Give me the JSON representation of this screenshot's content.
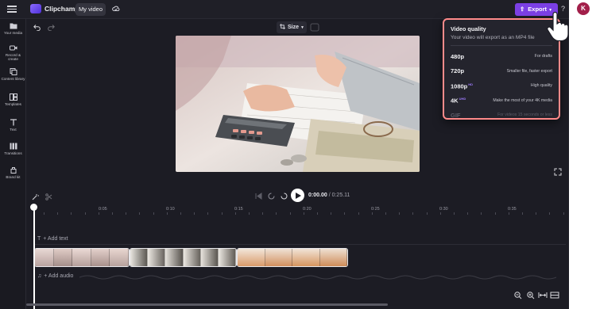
{
  "app": {
    "name": "Clipchamp",
    "project_tab": "My video",
    "export_label": "Export",
    "help_label": "?",
    "avatar_initial": "K",
    "accent_color": "#7b3fe4"
  },
  "sidebar": {
    "items": [
      {
        "label": "Your media",
        "icon": "folder-icon"
      },
      {
        "label": "Record & create",
        "icon": "video-camera-icon"
      },
      {
        "label": "Content library",
        "icon": "library-icon"
      },
      {
        "label": "Templates",
        "icon": "templates-icon"
      },
      {
        "label": "Text",
        "icon": "text-icon"
      },
      {
        "label": "Transitions",
        "icon": "transitions-icon"
      },
      {
        "label": "Brand kit",
        "icon": "brand-kit-icon"
      }
    ]
  },
  "toolbar": {
    "size_label": "Size"
  },
  "player": {
    "current_time": "0:00.00",
    "total_time": "/ 0:25.11"
  },
  "timeline": {
    "ticks": [
      "0:05",
      "0:10",
      "0:15",
      "0:20",
      "0:25",
      "0:30",
      "0:35"
    ],
    "add_text": "+ Add text",
    "add_audio": "+ Add audio"
  },
  "export_menu": {
    "title": "Video quality",
    "subtitle": "Your video will export as an MP4 file",
    "options": [
      {
        "quality": "480p",
        "badge": "",
        "description": "For drafts",
        "enabled": true
      },
      {
        "quality": "720p",
        "badge": "",
        "description": "Smaller file, faster export",
        "enabled": true
      },
      {
        "quality": "1080p",
        "badge": "HD",
        "description": "High quality",
        "enabled": true
      },
      {
        "quality": "4K",
        "badge": "UHD",
        "description": "Make the most of your 4K media",
        "enabled": true
      },
      {
        "quality": "GIF",
        "badge": "",
        "description": "For videos 15 seconds or less",
        "enabled": false
      }
    ]
  }
}
